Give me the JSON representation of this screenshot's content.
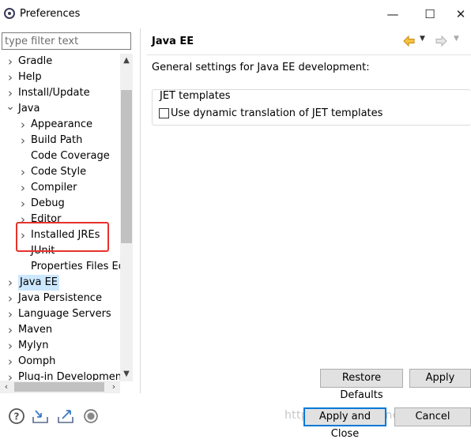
{
  "window": {
    "title": "Preferences",
    "minimize": "—",
    "maximize": "☐",
    "close": "✕"
  },
  "filter": {
    "placeholder": "type filter text",
    "value": ""
  },
  "tree": {
    "items": [
      {
        "label": "Gradle",
        "level": 0,
        "expandable": true,
        "expanded": false,
        "selected": false
      },
      {
        "label": "Help",
        "level": 0,
        "expandable": true,
        "expanded": false,
        "selected": false
      },
      {
        "label": "Install/Update",
        "level": 0,
        "expandable": true,
        "expanded": false,
        "selected": false
      },
      {
        "label": "Java",
        "level": 0,
        "expandable": true,
        "expanded": true,
        "selected": false
      },
      {
        "label": "Appearance",
        "level": 1,
        "expandable": true,
        "expanded": false,
        "selected": false
      },
      {
        "label": "Build Path",
        "level": 1,
        "expandable": true,
        "expanded": false,
        "selected": false
      },
      {
        "label": "Code Coverage",
        "level": 1,
        "expandable": false,
        "expanded": false,
        "selected": false
      },
      {
        "label": "Code Style",
        "level": 1,
        "expandable": true,
        "expanded": false,
        "selected": false
      },
      {
        "label": "Compiler",
        "level": 1,
        "expandable": true,
        "expanded": false,
        "selected": false
      },
      {
        "label": "Debug",
        "level": 1,
        "expandable": true,
        "expanded": false,
        "selected": false
      },
      {
        "label": "Editor",
        "level": 1,
        "expandable": true,
        "expanded": false,
        "selected": false
      },
      {
        "label": "Installed JREs",
        "level": 1,
        "expandable": true,
        "expanded": false,
        "selected": false
      },
      {
        "label": "JUnit",
        "level": 1,
        "expandable": false,
        "expanded": false,
        "selected": false
      },
      {
        "label": "Properties Files Edi",
        "level": 1,
        "expandable": false,
        "expanded": false,
        "selected": false
      },
      {
        "label": "Java EE",
        "level": 0,
        "expandable": true,
        "expanded": false,
        "selected": true
      },
      {
        "label": "Java Persistence",
        "level": 0,
        "expandable": true,
        "expanded": false,
        "selected": false
      },
      {
        "label": "Language Servers",
        "level": 0,
        "expandable": true,
        "expanded": false,
        "selected": false
      },
      {
        "label": "Maven",
        "level": 0,
        "expandable": true,
        "expanded": false,
        "selected": false
      },
      {
        "label": "Mylyn",
        "level": 0,
        "expandable": true,
        "expanded": false,
        "selected": false
      },
      {
        "label": "Oomph",
        "level": 0,
        "expandable": true,
        "expanded": false,
        "selected": false
      },
      {
        "label": "Plug-in Development",
        "level": 0,
        "expandable": true,
        "expanded": false,
        "selected": false
      }
    ]
  },
  "page": {
    "title": "Java EE",
    "description": "General settings for Java EE development:",
    "group_title": "JET templates",
    "checkbox_label": "Use dynamic translation of JET templates",
    "checkbox_checked": false
  },
  "buttons": {
    "restore_defaults": "Restore Defaults",
    "apply": "Apply",
    "apply_and_close": "Apply and Close",
    "cancel": "Cancel"
  },
  "watermark": "https://blog.csdn.net/Emotion",
  "colors": {
    "selection": "#cce8ff",
    "highlight_box": "#e8322b",
    "default_button_border": "#0078d7",
    "back_arrow": "#e8a317"
  },
  "icons": [
    "eclipse-app-icon",
    "help-icon",
    "import-icon",
    "export-icon",
    "record-icon",
    "back-arrow-icon",
    "forward-arrow-icon"
  ]
}
